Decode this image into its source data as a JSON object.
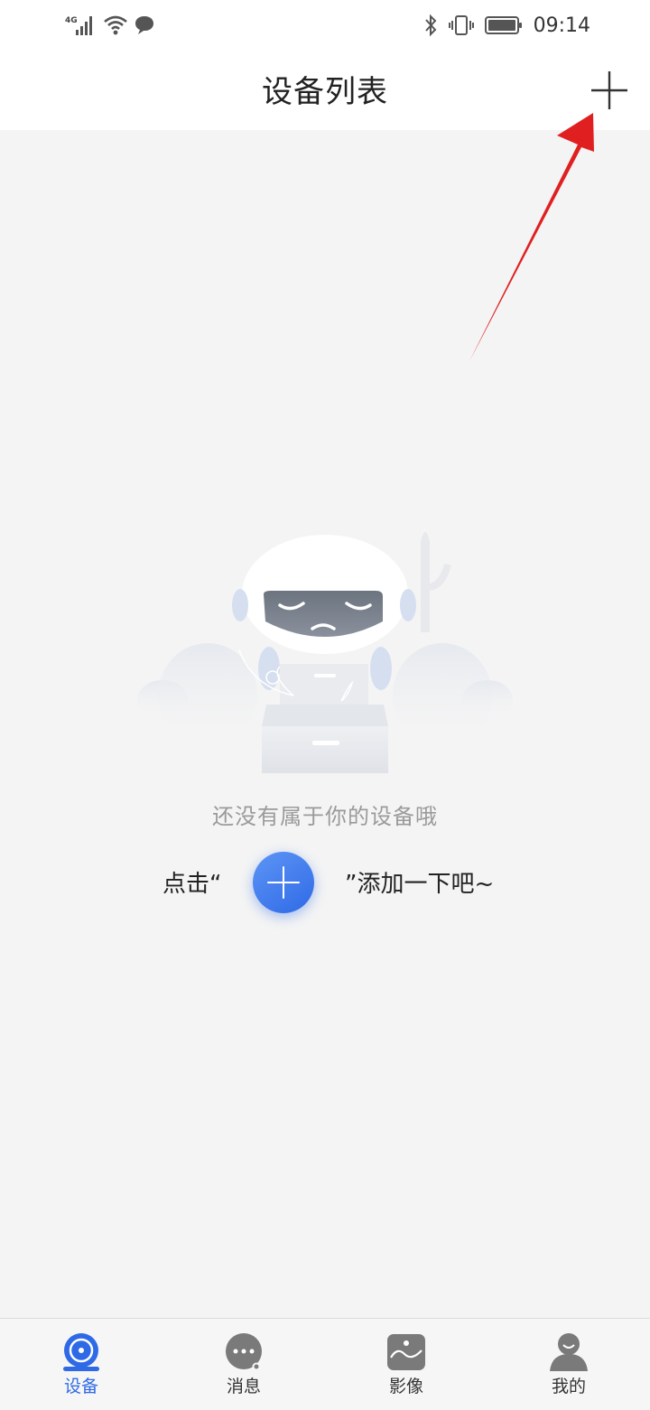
{
  "status_bar": {
    "network": "4G",
    "time": "09:14",
    "icons": [
      "signal-icon",
      "wifi-icon",
      "message-icon",
      "bluetooth-icon",
      "vibrate-icon",
      "battery-icon"
    ]
  },
  "header": {
    "title": "设备列表",
    "add_icon": "plus-icon"
  },
  "empty_state": {
    "message": "还没有属于你的设备哦",
    "hint_before": "点击“",
    "hint_after": "”添加一下吧~",
    "illustration": "robot-empty-drawer-illustration"
  },
  "annotation": {
    "arrow_color": "#e02020"
  },
  "bottom_nav": {
    "items": [
      {
        "label": "设备",
        "icon": "camera-icon",
        "active": true
      },
      {
        "label": "消息",
        "icon": "message-dots-icon",
        "active": false
      },
      {
        "label": "影像",
        "icon": "gallery-icon",
        "active": false
      },
      {
        "label": "我的",
        "icon": "person-icon",
        "active": false
      }
    ]
  },
  "colors": {
    "accent": "#2f6ae6",
    "background": "#f4f4f4",
    "header_background": "#ffffff",
    "icon_gray": "#7a7a7a"
  }
}
